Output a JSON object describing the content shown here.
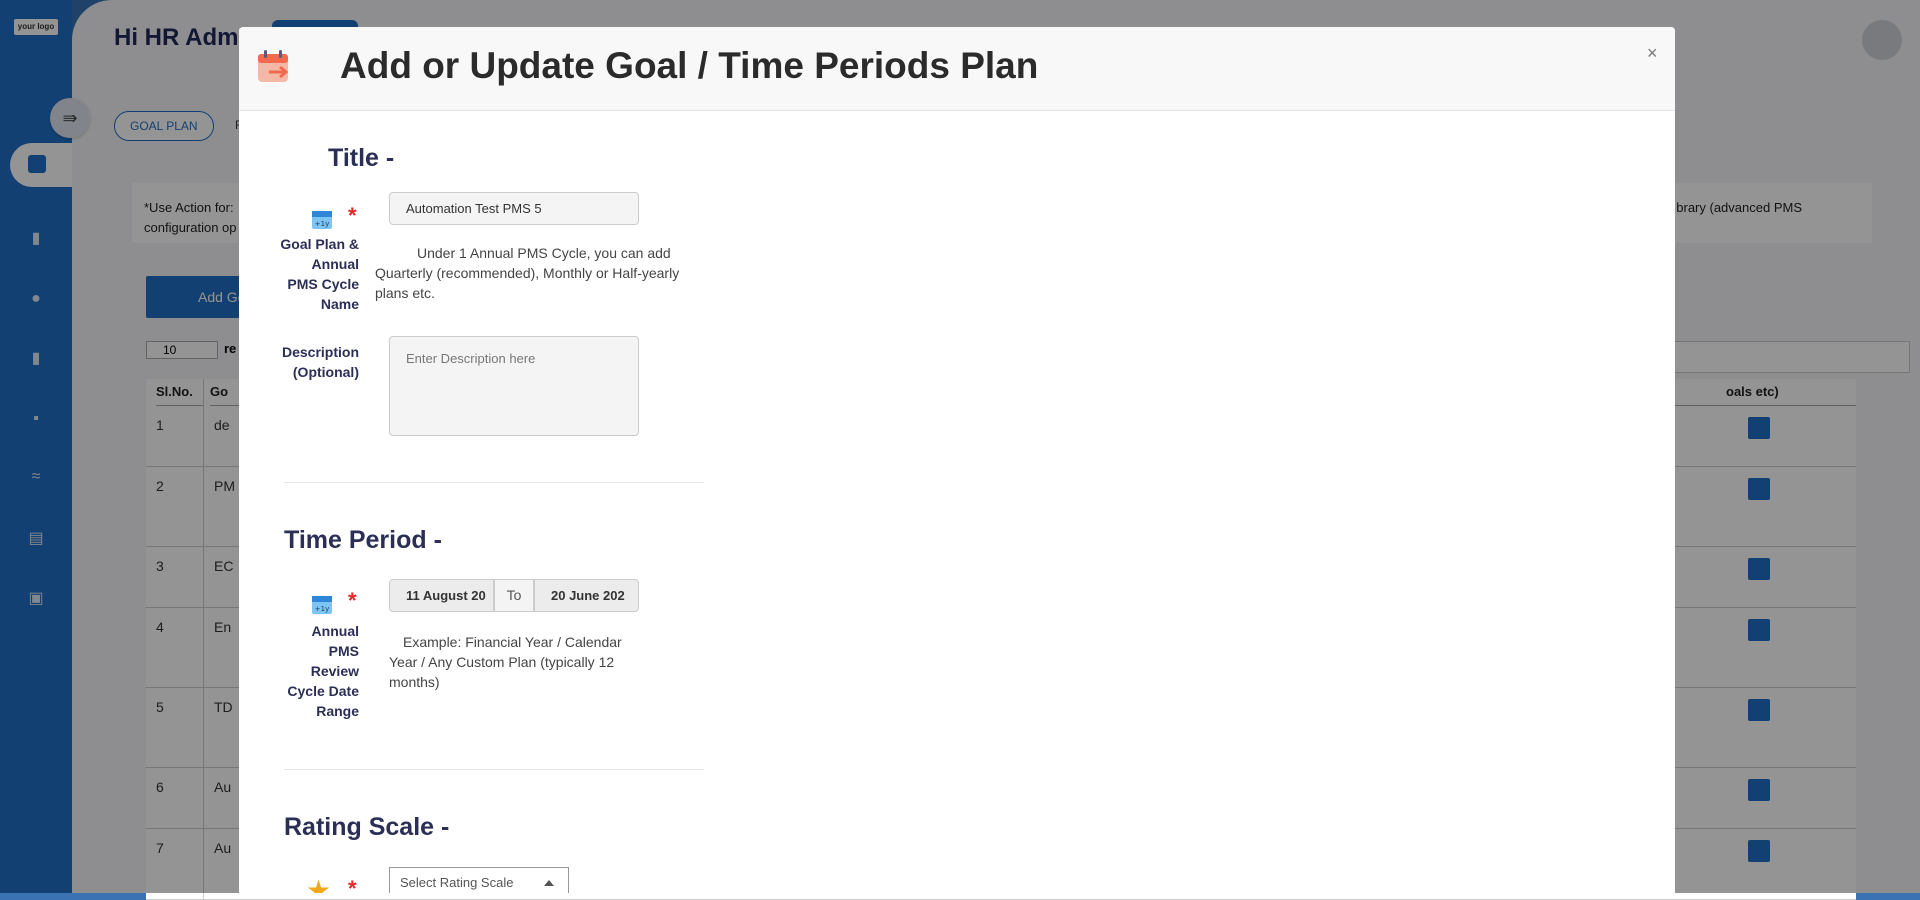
{
  "bg": {
    "logo": "your logo",
    "greeting": "Hi HR Admi",
    "tabs": [
      "GOAL PLAN",
      "F"
    ],
    "notice": "*Use Action for: ",
    "notice_line2": "configuration op",
    "notice_right": "brary (advanced PMS",
    "add_button": "Add Go",
    "entries_value": "10",
    "entries_suffix": "re",
    "table": {
      "headers": [
        "Sl.No.",
        "Go",
        "oals etc)"
      ],
      "rows": [
        {
          "sl": "1",
          "goal": "de"
        },
        {
          "sl": "2",
          "goal": "PM"
        },
        {
          "sl": "3",
          "goal": "EC"
        },
        {
          "sl": "4",
          "goal": "En"
        },
        {
          "sl": "5",
          "goal": "TD"
        },
        {
          "sl": "6",
          "goal": "Au"
        },
        {
          "sl": "7",
          "goal": "Au"
        }
      ]
    },
    "sidebar_icons": [
      "chart-icon",
      "book-icon",
      "users-icon",
      "book-icon",
      "chart-icon",
      "handshake-icon",
      "form-icon",
      "calendar-icon"
    ]
  },
  "modal": {
    "title": "Add or Update Goal / Time Periods Plan",
    "close_symbol": "×",
    "sections": {
      "title": {
        "heading": "Title -",
        "name_label_lines": [
          "Goal Plan &",
          "Annual",
          "PMS Cycle",
          "Name"
        ],
        "name_value": "Automation Test PMS 5",
        "name_help_line1": "Under 1 Annual PMS Cycle, you can add",
        "name_help_line2": "Quarterly (recommended), Monthly or Half-yearly",
        "name_help_line3": "plans etc.",
        "desc_label_lines": [
          "Description",
          "(Optional)"
        ],
        "desc_placeholder": "Enter Description here"
      },
      "time_period": {
        "heading": "Time Period -",
        "label_lines": [
          "Annual",
          "PMS",
          "Review",
          "Cycle Date",
          "Range"
        ],
        "start_date": "11 August 20",
        "to_label": "To",
        "end_date": "20 June 202",
        "help_line1": "Example: Financial Year / Calendar",
        "help_line2": "Year / Any Custom Plan (typically 12",
        "help_line3": "months)"
      },
      "rating_scale": {
        "heading": "Rating Scale -",
        "select_placeholder": "Select Rating Scale"
      }
    },
    "required_mark": "*"
  },
  "colors": {
    "primary": "#1f6fc5",
    "heading": "#2b2f55",
    "required": "#e32626"
  }
}
